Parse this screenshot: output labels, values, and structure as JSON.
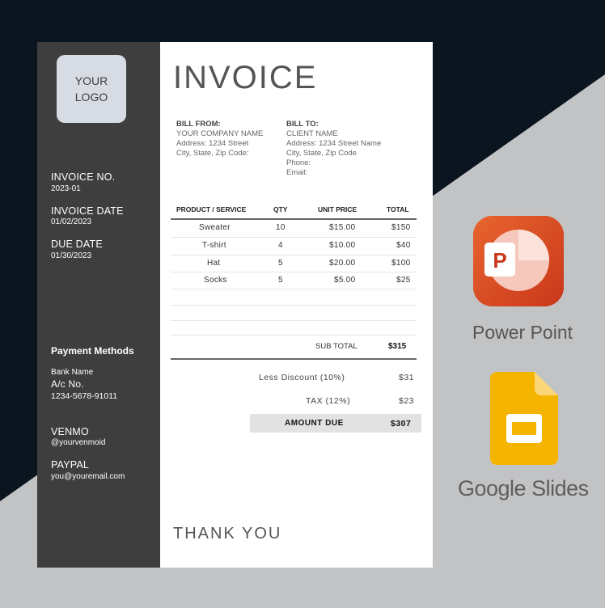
{
  "colors": {
    "dark_bg": "#0b1520",
    "light_bg": "#c2c3c5",
    "sidebar": "#3e3e3e",
    "logo_box": "#d6dbe4",
    "powerpoint": "#d7471f",
    "slides": "#f5b400"
  },
  "sidebar": {
    "logo_line1": "YOUR",
    "logo_line2": "LOGO",
    "invoice_no_label": "INVOICE NO.",
    "invoice_no": "2023-01",
    "invoice_date_label": "INVOICE DATE",
    "invoice_date": "01/02/2023",
    "due_date_label": "DUE DATE",
    "due_date": "01/30/2023",
    "payment_heading": "Payment Methods",
    "bank_name": "Bank Name",
    "ac_no_label": "A/c No.",
    "ac_no": "1234-5678-91011",
    "venmo_label": "VENMO",
    "venmo_id": "@yourvenmoid",
    "paypal_label": "PAYPAL",
    "paypal_email": "you@youremail.com"
  },
  "invoice": {
    "title": "INVOICE",
    "bill_from": {
      "heading": "BILL FROM:",
      "name": "YOUR COMPANY NAME",
      "address": "Address: 1234 Street",
      "city": "City, State, Zip Code:"
    },
    "bill_to": {
      "heading": "BILL TO:",
      "name": "CLIENT NAME",
      "address": "Address: 1234 Street Name",
      "city": "City, State, Zip Code",
      "phone": "Phone:",
      "email": "Email:"
    },
    "columns": [
      "PRODUCT / SERVICE",
      "QTY",
      "UNIT PRICE",
      "TOTAL"
    ],
    "rows": [
      {
        "product": "Sweater",
        "qty": "10",
        "unit_price": "$15.00",
        "total": "$150"
      },
      {
        "product": "T-shirt",
        "qty": "4",
        "unit_price": "$10.00",
        "total": "$40"
      },
      {
        "product": "Hat",
        "qty": "5",
        "unit_price": "$20.00",
        "total": "$100"
      },
      {
        "product": "Socks",
        "qty": "5",
        "unit_price": "$5.00",
        "total": "$25"
      }
    ],
    "subtotal_label": "SUB TOTAL",
    "subtotal": "$315",
    "discount_label": "Less Discount (10%)",
    "discount": "$31",
    "tax_label": "TAX (12%)",
    "tax": "$23",
    "amount_due_label": "AMOUNT DUE",
    "amount_due": "$307",
    "thank_you": "THANK YOU"
  },
  "apps": {
    "powerpoint_label": "Power Point",
    "powerpoint_icon": "powerpoint-icon",
    "slides_label": "Google Slides",
    "slides_icon": "google-slides-icon"
  }
}
